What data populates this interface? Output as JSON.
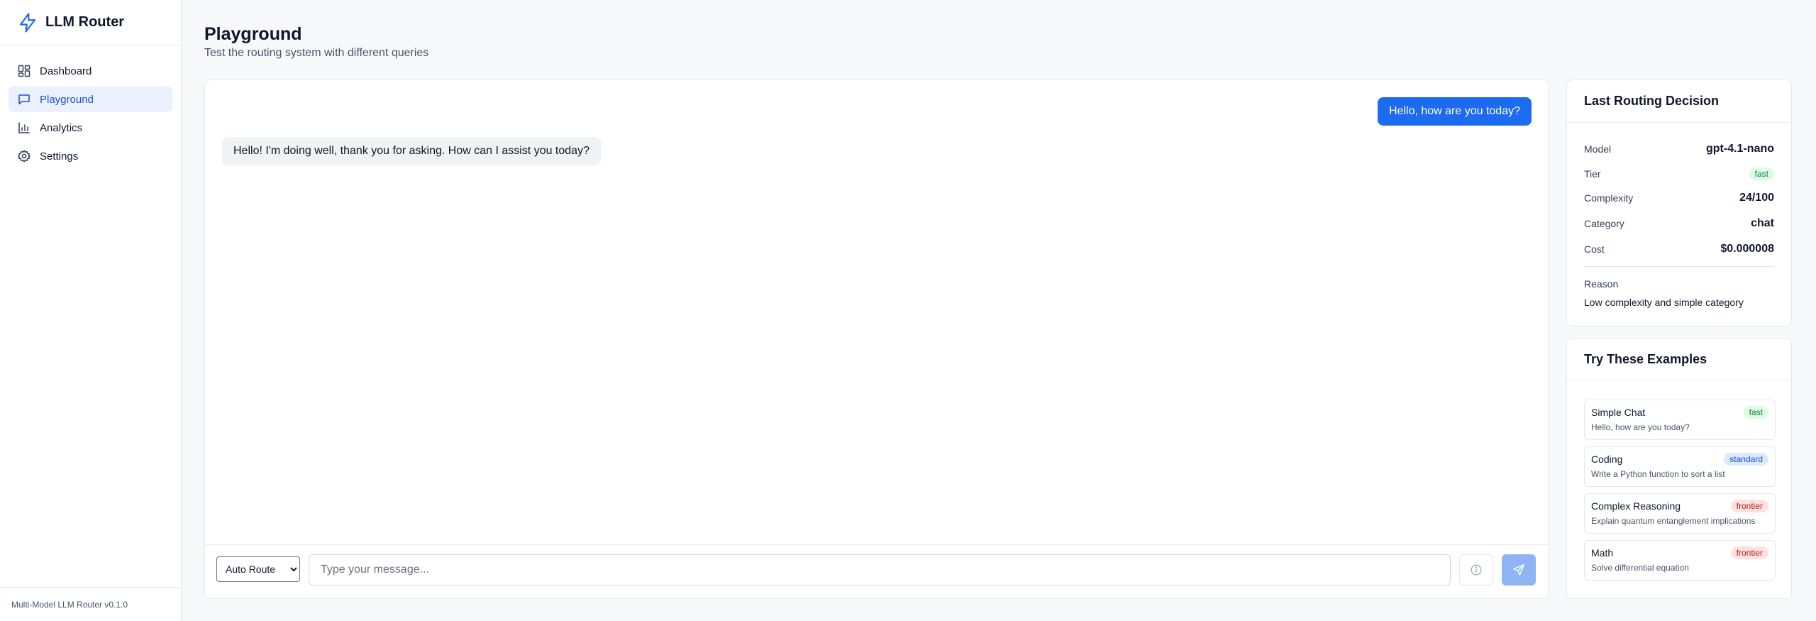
{
  "app": {
    "name": "LLM Router",
    "version_label": "Multi-Model LLM Router v0.1.0"
  },
  "sidebar": {
    "items": [
      {
        "label": "Dashboard",
        "icon": "grid-icon",
        "active": false
      },
      {
        "label": "Playground",
        "icon": "message-square-icon",
        "active": true
      },
      {
        "label": "Analytics",
        "icon": "bar-chart-icon",
        "active": false
      },
      {
        "label": "Settings",
        "icon": "gear-icon",
        "active": false
      }
    ]
  },
  "header": {
    "title": "Playground",
    "subtitle": "Test the routing system with different queries"
  },
  "chat": {
    "messages": [
      {
        "role": "user",
        "text": "Hello, how are you today?"
      },
      {
        "role": "assistant",
        "text": "Hello! I'm doing well, thank you for asking. How can I assist you today?"
      }
    ],
    "route_select": {
      "selected": "Auto Route"
    },
    "input": {
      "value": "",
      "placeholder": "Type your message..."
    }
  },
  "routing_decision": {
    "title": "Last Routing Decision",
    "model_label": "Model",
    "model_value": "gpt-4.1-nano",
    "tier_label": "Tier",
    "tier_value": "fast",
    "complexity_label": "Complexity",
    "complexity_value": "24/100",
    "category_label": "Category",
    "category_value": "chat",
    "cost_label": "Cost",
    "cost_value": "$0.000008",
    "reason_label": "Reason",
    "reason_value": "Low complexity and simple category"
  },
  "examples": {
    "title": "Try These Examples",
    "items": [
      {
        "title": "Simple Chat",
        "tier": "fast",
        "description": "Hello, how are you today?"
      },
      {
        "title": "Coding",
        "tier": "standard",
        "description": "Write a Python function to sort a list"
      },
      {
        "title": "Complex Reasoning",
        "tier": "frontier",
        "description": "Explain quantum entanglement implications"
      },
      {
        "title": "Math",
        "tier": "frontier",
        "description": "Solve differential equation"
      }
    ]
  },
  "colors": {
    "accent": "#1d6bf0",
    "active_nav_bg": "#eaf1fd",
    "fast": "#15803d",
    "standard": "#1d4ed8",
    "frontier": "#b91c1c"
  }
}
